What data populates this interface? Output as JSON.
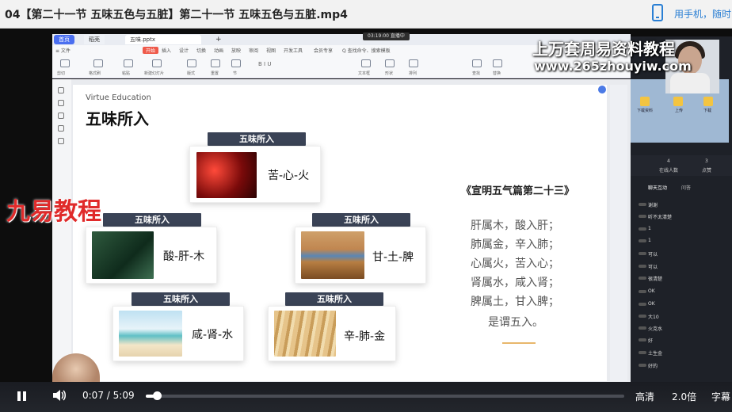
{
  "page": {
    "video_title": "04【第二十一节 五味五色与五脏】第二十一节 五味五色与五脏.mp4",
    "phone_prompt": "用手机，随时"
  },
  "wps": {
    "tabs": [
      "首页",
      "稻壳",
      "五味.pptx",
      "+"
    ],
    "status": "03:19:00  直播中",
    "menu": [
      "≡ 文件",
      "开始",
      "插入",
      "设计",
      "切换",
      "动画",
      "放映",
      "审阅",
      "视图",
      "开发工具",
      "会员专享",
      "Q 查找命令、搜索模板"
    ],
    "ribbon_labels": [
      "剪切",
      "格式刷",
      "粘贴",
      "新建幻灯片",
      "版式",
      "重置",
      "节",
      "B I U",
      "文本框",
      "形状",
      "排列",
      "查找",
      "替换"
    ]
  },
  "slide": {
    "eng_title": "Virtue Education",
    "title": "五味所入",
    "cards": [
      {
        "header": "五味所入",
        "label": "苦-心-火"
      },
      {
        "header": "五味所入",
        "label": "酸-肝-木"
      },
      {
        "header": "五味所入",
        "label": "甘-土-脾"
      },
      {
        "header": "五味所入",
        "label": "咸-肾-水"
      },
      {
        "header": "五味所入",
        "label": "辛-肺-金"
      }
    ],
    "poem_title": "《宣明五气篇第二十三》",
    "poem_lines": [
      "肝属木，酸入肝；",
      "肺属金，辛入肺；",
      "心属火，苦入心；",
      "肾属水，咸入肾；",
      "脾属土，甘入脾；",
      "是谓五入。"
    ]
  },
  "watermark": {
    "line1": "上万套周易资料教程",
    "line2": "www.265zhouyiw.com",
    "left": "九易教程"
  },
  "live_panel": {
    "board_icons": [
      "下载资料",
      "上传",
      "下载"
    ],
    "stats": [
      "4",
      "3"
    ],
    "stat_labels": [
      "在线人数",
      "点赞"
    ],
    "tabs": [
      "聊天互动",
      "问答"
    ],
    "chat": [
      "谢谢",
      "听不太清楚",
      "1",
      "1",
      "可以",
      "可以",
      "很清楚",
      "OK",
      "OK",
      "大10",
      "火克水",
      "好",
      "土生金",
      "好的"
    ]
  },
  "player": {
    "current_time": "0:07",
    "duration": "5:09",
    "progress": 0.023,
    "quality": "高清",
    "speed": "2.0倍",
    "subtitle": "字幕"
  }
}
